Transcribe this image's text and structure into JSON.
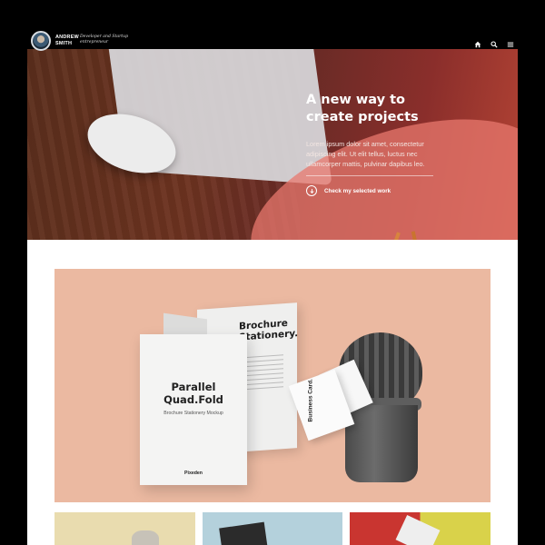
{
  "header": {
    "name": "ANDREW SMITH",
    "tagline": "Developer and Startup entrepreneur",
    "icons": [
      "home-icon",
      "search-icon",
      "menu-icon"
    ]
  },
  "hero": {
    "title": "A new way to create projects",
    "body": "Lorem ipsum dolor sit amet, consectetur adipiscing elit. Ut elit tellus, luctus nec ullamcorper mattis, pulvinar dapibus leo.",
    "cta_label": "Check my selected work",
    "cta_icon": "arrow-down-circle-icon"
  },
  "featured": {
    "brochure_title": "Parallel Quad.Fold",
    "brochure_subtitle": "Brochure Stationery Mockup",
    "brochure_brand": "Pixeden",
    "back_title": "Brochure Stationery.",
    "card_title": "Business Card."
  },
  "colors": {
    "header_bg": "#000000",
    "hero_accent": "#b34334",
    "featured_bg": "#ebb9a1"
  }
}
